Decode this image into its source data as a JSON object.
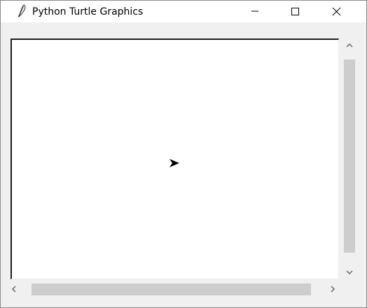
{
  "window": {
    "title": "Python Turtle Graphics",
    "app_icon": "feather-icon"
  },
  "title_controls": {
    "minimize_icon": "minimize-icon",
    "maximize_icon": "maximize-icon",
    "close_icon": "close-icon"
  },
  "canvas": {
    "background": "#ffffff",
    "turtle_shape": "arrow-icon",
    "turtle_color": "#000000",
    "turtle_heading": "right"
  },
  "scrollbars": {
    "vertical": {
      "up_icon": "chevron-up-icon",
      "down_icon": "chevron-down-icon"
    },
    "horizontal": {
      "left_icon": "chevron-left-icon",
      "right_icon": "chevron-right-icon"
    },
    "thumb_color": "#cdcdcd"
  }
}
